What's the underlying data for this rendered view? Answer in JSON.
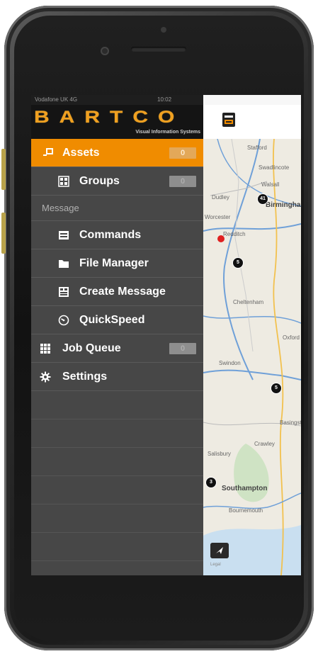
{
  "status_bar": {
    "carrier": "Vodafone UK 4G",
    "time": "10:02"
  },
  "brand": {
    "logo_text": "BARTCO",
    "tagline": "Visual Information Systems",
    "accent": "#f08c00"
  },
  "menu": {
    "assets": {
      "label": "Assets",
      "count": "0",
      "icon": "assets-icon"
    },
    "groups": {
      "label": "Groups",
      "count": "0",
      "icon": "groups-icon"
    },
    "section_message": "Message",
    "commands": {
      "label": "Commands",
      "icon": "commands-icon"
    },
    "file_manager": {
      "label": "File Manager",
      "icon": "folder-icon"
    },
    "create_message": {
      "label": "Create Message",
      "icon": "create-message-icon"
    },
    "quickspeed": {
      "label": "QuickSpeed",
      "icon": "speed-icon"
    },
    "job_queue": {
      "label": "Job Queue",
      "count": "0",
      "icon": "job-queue-icon"
    },
    "settings": {
      "label": "Settings",
      "icon": "gear-icon"
    }
  },
  "map": {
    "towns": {
      "stafford": "Stafford",
      "swadlincote": "Swadlincote",
      "walsall": "Walsall",
      "dudley": "Dudley",
      "birmingham": "Birmingham",
      "worcester": "Worcester",
      "redditch": "Redditch",
      "cheltenham": "Cheltenham",
      "oxford": "Oxford",
      "swindon": "Swindon",
      "basingstoke": "Basingstoke",
      "crawley": "Crawley",
      "salisbury": "Salisbury",
      "southampton": "Southampton",
      "bournemouth": "Bournemouth"
    },
    "markers": {
      "m1": "41",
      "m2": "5",
      "m3": "5",
      "m4": "3"
    },
    "legal": "Legal"
  }
}
